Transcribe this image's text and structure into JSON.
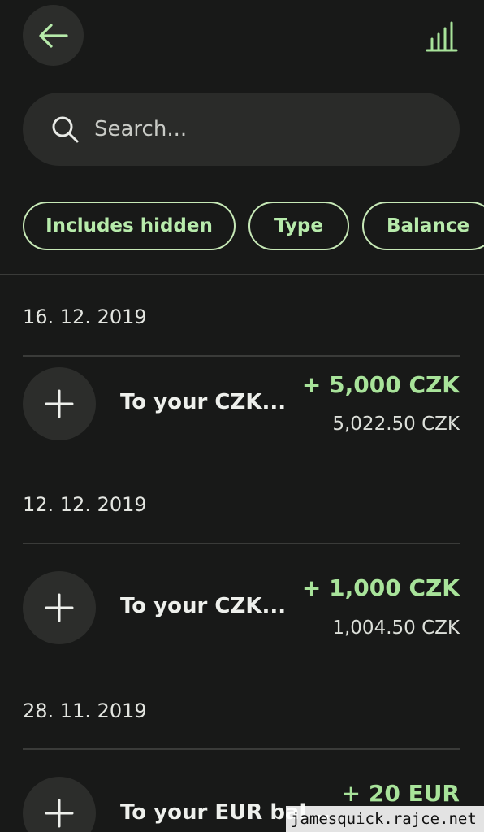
{
  "header": {
    "back_icon": "arrow-left-icon",
    "stats_icon": "bar-chart-icon"
  },
  "search": {
    "placeholder": "Search...",
    "icon": "search-icon"
  },
  "filters": [
    {
      "label": "Includes hidden"
    },
    {
      "label": "Type"
    },
    {
      "label": "Balance"
    }
  ],
  "groups": [
    {
      "date": "16. 12. 2019",
      "transactions": [
        {
          "title": "To your CZK...",
          "amount": "+ 5,000 CZK",
          "balance": "5,022.50 CZK",
          "icon": "plus-icon"
        }
      ]
    },
    {
      "date": "12. 12. 2019",
      "transactions": [
        {
          "title": "To your CZK...",
          "amount": "+ 1,000 CZK",
          "balance": "1,004.50 CZK",
          "icon": "plus-icon"
        }
      ]
    },
    {
      "date": "28. 11. 2019",
      "transactions": [
        {
          "title": "To your EUR bal...",
          "amount": "+ 20 EUR",
          "balance": "",
          "icon": "plus-icon"
        }
      ]
    }
  ],
  "watermark": "jamesquick.rajce.net",
  "colors": {
    "background": "#181918",
    "accent_green": "#a8e39a",
    "surface": "#2c2d2b"
  }
}
